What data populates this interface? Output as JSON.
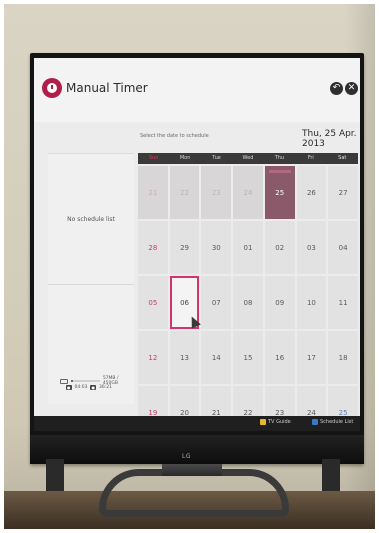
{
  "app": {
    "title": "Manual Timer",
    "icon": "clock-icon",
    "accent_color": "#b21e4a"
  },
  "header": {
    "back_icon": "back-arrow-icon",
    "close_icon": "close-icon",
    "back_glyph": "↶",
    "close_glyph": "✕"
  },
  "sidebar": {
    "empty_text": "No schedule list",
    "storage_line1": "57MB / 450GB",
    "storage_line2a": "04:03",
    "storage_line2b": "36:21"
  },
  "calendar": {
    "prompt": "Select the date to schedule",
    "selected_date": "Thu, 25 Apr. 2013",
    "weekdays": [
      "Sun",
      "Mon",
      "Tue",
      "Wed",
      "Thu",
      "Fri",
      "Sat"
    ],
    "rows": [
      [
        "",
        "",
        "",
        "",
        "",
        "",
        ""
      ],
      [
        "21",
        "22",
        "23",
        "24",
        "25",
        "26",
        "27"
      ],
      [
        "28",
        "29",
        "30",
        "01",
        "02",
        "03",
        "04"
      ],
      [
        "05",
        "06",
        "07",
        "08",
        "09",
        "10",
        "11"
      ],
      [
        "12",
        "13",
        "14",
        "15",
        "16",
        "17",
        "18"
      ],
      [
        "19",
        "20",
        "21",
        "22",
        "23",
        "24",
        "25"
      ]
    ]
  },
  "footer": {
    "guide_label": "TV Guide",
    "schedule_label": "Schedule List"
  },
  "tv": {
    "brand": "LG"
  }
}
